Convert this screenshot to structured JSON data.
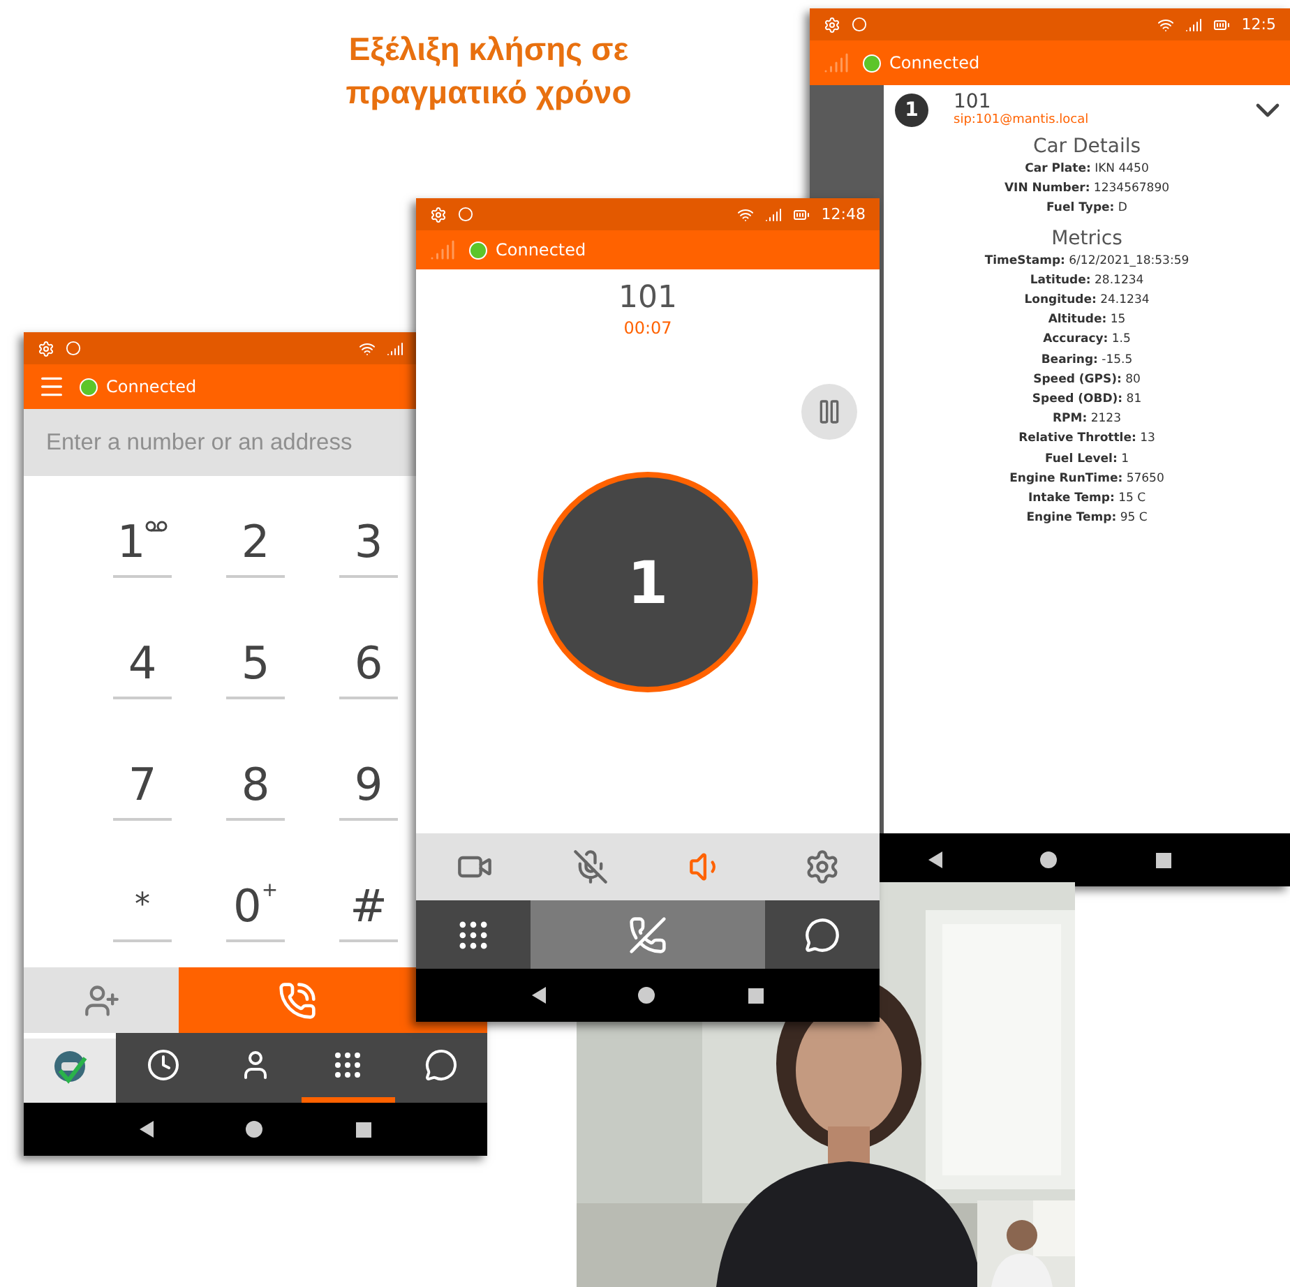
{
  "title_lines": [
    "Εξέλιξη κλήσης σε",
    "πραγματικό χρόνο"
  ],
  "dialer": {
    "connection": "Connected",
    "placeholder": "Enter a number or an address",
    "keys": [
      {
        "kind": "voicemail",
        "digit": "1"
      },
      {
        "kind": "plain",
        "digit": "2"
      },
      {
        "kind": "plain",
        "digit": "3"
      },
      {
        "kind": "plain",
        "digit": "4"
      },
      {
        "kind": "plain",
        "digit": "5"
      },
      {
        "kind": "plain",
        "digit": "6"
      },
      {
        "kind": "plain",
        "digit": "7"
      },
      {
        "kind": "plain",
        "digit": "8"
      },
      {
        "kind": "plain",
        "digit": "9"
      },
      {
        "kind": "small",
        "digit": "*"
      },
      {
        "kind": "plus",
        "digit": "0",
        "sup": "+"
      },
      {
        "kind": "plain",
        "digit": "#"
      }
    ],
    "tabs": [
      {
        "kind": "logo",
        "selected": false
      },
      {
        "kind": "history",
        "selected": false
      },
      {
        "kind": "contacts",
        "selected": false
      },
      {
        "kind": "dialpad",
        "selected": true
      },
      {
        "kind": "chat",
        "selected": false
      }
    ]
  },
  "call": {
    "time": "12:48",
    "connection": "Connected",
    "number": "101",
    "duration": "00:07",
    "avatar_label": "1",
    "controls": [
      {
        "kind": "video",
        "active": false
      },
      {
        "kind": "mic-off",
        "active": false
      },
      {
        "kind": "speaker",
        "active": true
      },
      {
        "kind": "settings",
        "active": false
      }
    ]
  },
  "details": {
    "time": "12:5",
    "connection": "Connected",
    "badge": "1",
    "number": "101",
    "address": "sip:101@mantis.local",
    "sections": [
      {
        "heading": "Car Details",
        "lines": [
          "**Car Plate:** IKN 4450",
          "**VIN Number:** 1234567890",
          "**Fuel Type:** D"
        ]
      },
      {
        "heading": "Metrics",
        "lines": [
          "**TimeStamp:** 6/12/2021_18:53:59",
          "**Latitude:** 28.1234",
          "**Longitude:** 24.1234",
          "**Altitude:** 15",
          "**Accuracy:** 1.5",
          "**Bearing:** -15.5",
          "**Speed (GPS):** 80",
          "**Speed (OBD):** 81",
          "**RPM:** 2123",
          "**Relative Throttle:** 13",
          "**Fuel Level:** 1",
          "**Engine RunTime:** 57650",
          "**Intake Temp:** 15 C",
          "**Engine Temp:** 95 C"
        ]
      }
    ]
  },
  "video": {
    "kind": "picture"
  }
}
